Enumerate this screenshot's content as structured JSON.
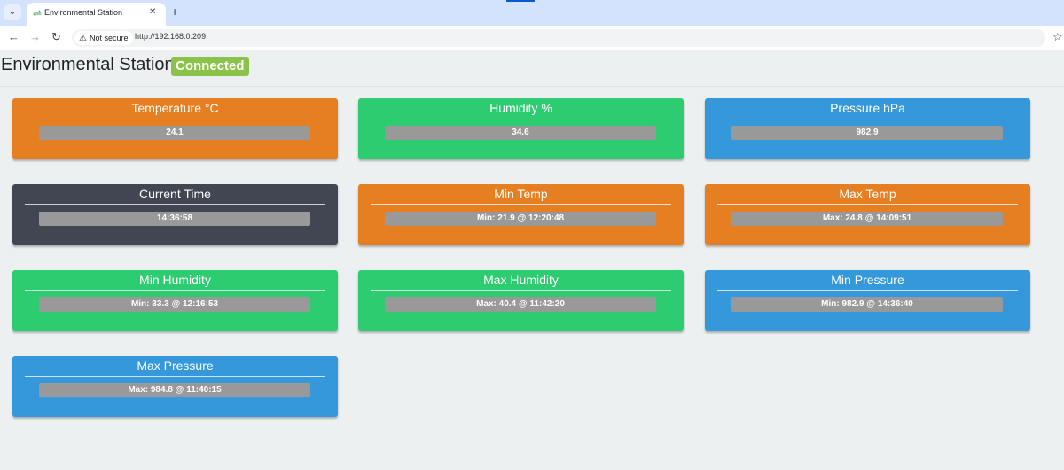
{
  "browser": {
    "tab_title": "Environmental Station",
    "tab_menu_icon": "chevron-down-icon",
    "tab_favicon_icon": "sync-arrows-icon",
    "security_label": "Not secure",
    "url": "http://192.168.0.209",
    "new_tab_icon": "plus-icon"
  },
  "header": {
    "title": "Environmental Station",
    "status": "Connected"
  },
  "colors": {
    "orange": "#e67e22",
    "green": "#2ecc71",
    "blue": "#3498db",
    "dark": "#414652",
    "badge": "#8bc34a",
    "value_bar": "#999999"
  },
  "cards": [
    {
      "title": "Temperature °C",
      "value": "24.1",
      "color": "orange"
    },
    {
      "title": "Humidity %",
      "value": "34.6",
      "color": "green"
    },
    {
      "title": "Pressure hPa",
      "value": "982.9",
      "color": "blue"
    },
    {
      "title": "Current Time",
      "value": "14:36:58",
      "color": "dark"
    },
    {
      "title": "Min Temp",
      "value": "Min: 21.9 @ 12:20:48",
      "color": "orange"
    },
    {
      "title": "Max Temp",
      "value": "Max: 24.8 @ 14:09:51",
      "color": "orange"
    },
    {
      "title": "Min Humidity",
      "value": "Min: 33.3 @ 12:16:53",
      "color": "green"
    },
    {
      "title": "Max Humidity",
      "value": "Max: 40.4 @ 11:42:20",
      "color": "green"
    },
    {
      "title": "Min Pressure",
      "value": "Min: 982.9 @ 14:36:40",
      "color": "blue"
    },
    {
      "title": "Max Pressure",
      "value": "Max: 984.8 @ 11:40:15",
      "color": "blue"
    }
  ]
}
